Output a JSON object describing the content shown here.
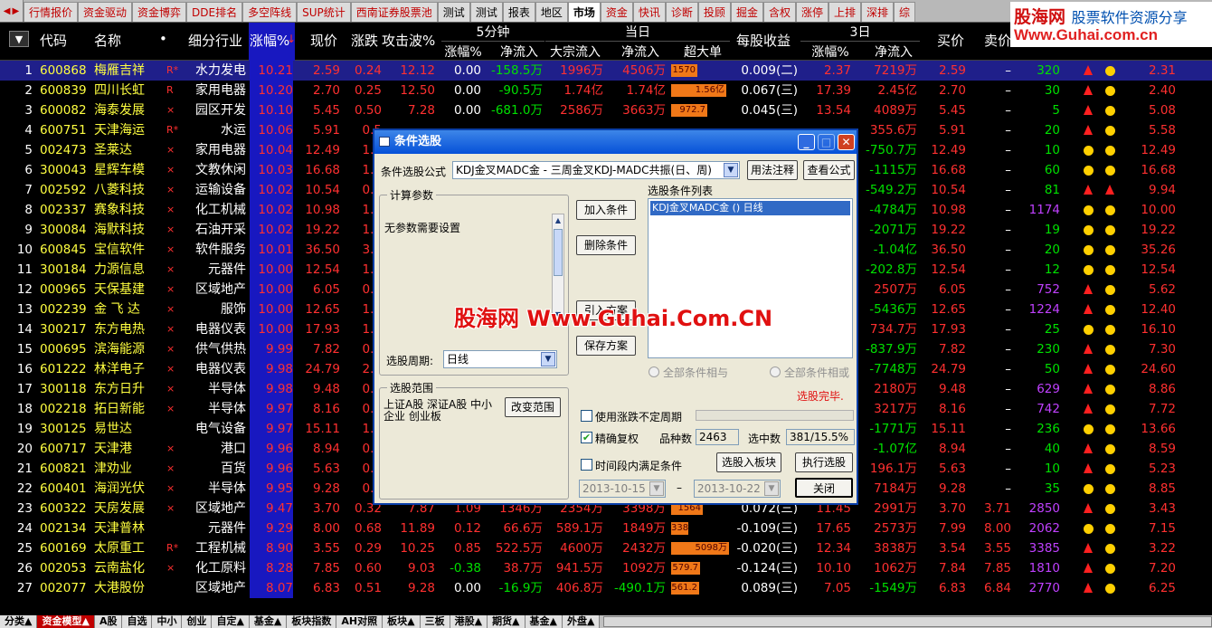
{
  "top_tabs": [
    {
      "label": "行情报价",
      "style": "red"
    },
    {
      "label": "资金驱动",
      "style": "red"
    },
    {
      "label": "资金博弈",
      "style": "red"
    },
    {
      "label": "DDE排名",
      "style": "red"
    },
    {
      "label": "多空阵线",
      "style": "red"
    },
    {
      "label": "SUP统计",
      "style": "red"
    },
    {
      "label": "西南证券股票池",
      "style": "red"
    },
    {
      "label": "测试",
      "style": "black"
    },
    {
      "label": "测试",
      "style": "black"
    },
    {
      "label": "报表",
      "style": "black"
    },
    {
      "label": "地区",
      "style": "black"
    },
    {
      "label": "市场",
      "style": "active"
    },
    {
      "label": "资金",
      "style": "red"
    },
    {
      "label": "快讯",
      "style": "red"
    },
    {
      "label": "诊断",
      "style": "red"
    },
    {
      "label": "投顾",
      "style": "red"
    },
    {
      "label": "掘金",
      "style": "red"
    },
    {
      "label": "含权",
      "style": "red"
    },
    {
      "label": "涨停",
      "style": "red"
    },
    {
      "label": "上排",
      "style": "red"
    },
    {
      "label": "深排",
      "style": "red"
    },
    {
      "label": "综",
      "style": "red"
    }
  ],
  "logo": {
    "name": "股海网",
    "tagline": "股票软件资源分享",
    "url": "Www.Guhai.com.cn"
  },
  "header": {
    "menu_icon": "▼",
    "code": "代码",
    "name": "名称",
    "dot": "•",
    "industry": "细分行业",
    "change_pct": "涨幅%",
    "change_arrow": "↓",
    "price": "现价",
    "change": "涨跌",
    "attack_wave": "攻击波%",
    "group_5min": "5分钟",
    "group_today": "当日",
    "group_3day": "3日",
    "sub_5min_pct": "涨幅%",
    "sub_5min_inflow": "净流入",
    "sub_block_inflow": "大宗流入",
    "sub_today_inflow": "净流入",
    "sub_super_order": "超大单",
    "eps": "每股收益",
    "sub_3d_pct": "涨幅%",
    "sub_3d_inflow": "净流入",
    "bid": "买价",
    "ask": "卖价"
  },
  "rows": [
    {
      "no": "1",
      "code": "600868",
      "name": "梅雁吉祥",
      "flag": "R*",
      "ind": "水力发电",
      "pct": "10.21",
      "price": "2.59",
      "chg": "0.24",
      "atk": "12.12",
      "m5": "0.00",
      "m5in": "-158.5万",
      "blk": "1996万",
      "net": "4506万",
      "sup": "1570万",
      "supv": 0.45,
      "eps": "0.009(二)",
      "d3": "2.37",
      "d3in": "7219万",
      "bid": "2.59",
      "ask": "–",
      "vol": "320",
      "i1": "tri",
      "i2": "dot",
      "last": "2.31"
    },
    {
      "no": "2",
      "code": "600839",
      "name": "四川长虹",
      "flag": "R",
      "ind": "家用电器",
      "pct": "10.20",
      "price": "2.70",
      "chg": "0.25",
      "atk": "12.50",
      "m5": "0.00",
      "m5in": "-90.5万",
      "blk": "1.74亿",
      "net": "1.74亿",
      "sup": "1.56亿",
      "supv": 0.95,
      "eps": "0.067(三)",
      "d3": "17.39",
      "d3in": "2.45亿",
      "bid": "2.70",
      "ask": "–",
      "vol": "30",
      "i1": "tri",
      "i2": "dot",
      "last": "2.40"
    },
    {
      "no": "3",
      "code": "600082",
      "name": "海泰发展",
      "flag": "×",
      "ind": "园区开发",
      "pct": "10.10",
      "price": "5.45",
      "chg": "0.50",
      "atk": "7.28",
      "m5": "0.00",
      "m5in": "-681.0万",
      "blk": "2586万",
      "net": "3663万",
      "sup": "972.7万",
      "supv": 0.62,
      "eps": "0.045(三)",
      "d3": "13.54",
      "d3in": "4089万",
      "bid": "5.45",
      "ask": "–",
      "vol": "5",
      "i1": "tri",
      "i2": "dot",
      "last": "5.08"
    },
    {
      "no": "4",
      "code": "600751",
      "name": "天津海运",
      "flag": "R*",
      "ind": "水运",
      "pct": "10.06",
      "price": "5.91",
      "chg": "0.5",
      "atk": "",
      "m5": "",
      "m5in": "",
      "blk": "",
      "net": "",
      "sup": "",
      "supv": 0,
      "eps": "",
      "d3": "",
      "d3in": "355.6万",
      "bid": "5.91",
      "ask": "–",
      "vol": "20",
      "i1": "tri",
      "i2": "dot",
      "last": "5.58"
    },
    {
      "no": "5",
      "code": "002473",
      "name": "圣莱达",
      "flag": "×",
      "ind": "家用电器",
      "pct": "10.04",
      "price": "12.49",
      "chg": "1.1",
      "atk": "",
      "m5": "",
      "m5in": "",
      "blk": "",
      "net": "",
      "sup": "",
      "supv": 0,
      "eps": "",
      "d3": "",
      "d3in": "-750.7万",
      "bid": "12.49",
      "ask": "–",
      "vol": "10",
      "i1": "dot",
      "i2": "dot",
      "last": "12.49"
    },
    {
      "no": "6",
      "code": "300043",
      "name": "星辉车模",
      "flag": "×",
      "ind": "文教休闲",
      "pct": "10.03",
      "price": "16.68",
      "chg": "1.5",
      "atk": "",
      "m5": "",
      "m5in": "",
      "blk": "",
      "net": "",
      "sup": "",
      "supv": 0,
      "eps": "",
      "d3": "",
      "d3in": "-1115万",
      "bid": "16.68",
      "ask": "–",
      "vol": "60",
      "i1": "dot",
      "i2": "dot",
      "last": "16.68"
    },
    {
      "no": "7",
      "code": "002592",
      "name": "八菱科技",
      "flag": "×",
      "ind": "运输设备",
      "pct": "10.02",
      "price": "10.54",
      "chg": "0.9",
      "atk": "",
      "m5": "",
      "m5in": "",
      "blk": "",
      "net": "",
      "sup": "",
      "supv": 0,
      "eps": "",
      "d3": "",
      "d3in": "-549.2万",
      "bid": "10.54",
      "ask": "–",
      "vol": "81",
      "i1": "tri",
      "i2": "tri",
      "last": "9.94"
    },
    {
      "no": "8",
      "code": "002337",
      "name": "赛象科技",
      "flag": "×",
      "ind": "化工机械",
      "pct": "10.02",
      "price": "10.98",
      "chg": "1.0",
      "atk": "",
      "m5": "",
      "m5in": "",
      "blk": "",
      "net": "",
      "sup": "",
      "supv": 0,
      "eps": "",
      "d3": "",
      "d3in": "-4784万",
      "bid": "10.98",
      "ask": "–",
      "vol": "1174",
      "i1": "dot",
      "i2": "dot",
      "last": "10.00"
    },
    {
      "no": "9",
      "code": "300084",
      "name": "海默科技",
      "flag": "×",
      "ind": "石油开采",
      "pct": "10.02",
      "price": "19.22",
      "chg": "1.7",
      "atk": "",
      "m5": "",
      "m5in": "",
      "blk": "",
      "net": "",
      "sup": "",
      "supv": 0,
      "eps": "",
      "d3": "",
      "d3in": "-2071万",
      "bid": "19.22",
      "ask": "–",
      "vol": "19",
      "i1": "dot",
      "i2": "dot",
      "last": "19.22"
    },
    {
      "no": "10",
      "code": "600845",
      "name": "宝信软件",
      "flag": "×",
      "ind": "软件服务",
      "pct": "10.01",
      "price": "36.50",
      "chg": "3.3",
      "atk": "",
      "m5": "",
      "m5in": "",
      "blk": "",
      "net": "",
      "sup": "",
      "supv": 0,
      "eps": "",
      "d3": "",
      "d3in": "-1.04亿",
      "bid": "36.50",
      "ask": "–",
      "vol": "20",
      "i1": "dot",
      "i2": "dot",
      "last": "35.26"
    },
    {
      "no": "11",
      "code": "300184",
      "name": "力源信息",
      "flag": "×",
      "ind": "元器件",
      "pct": "10.00",
      "price": "12.54",
      "chg": "1.1",
      "atk": "",
      "m5": "",
      "m5in": "",
      "blk": "",
      "net": "",
      "sup": "",
      "supv": 0,
      "eps": "",
      "d3": "",
      "d3in": "-202.8万",
      "bid": "12.54",
      "ask": "–",
      "vol": "12",
      "i1": "dot",
      "i2": "dot",
      "last": "12.54"
    },
    {
      "no": "12",
      "code": "000965",
      "name": "天保基建",
      "flag": "×",
      "ind": "区域地产",
      "pct": "10.00",
      "price": "6.05",
      "chg": "0.5",
      "atk": "",
      "m5": "",
      "m5in": "",
      "blk": "",
      "net": "",
      "sup": "",
      "supv": 0,
      "eps": "",
      "d3": "",
      "d3in": "2507万",
      "bid": "6.05",
      "ask": "–",
      "vol": "752",
      "i1": "tri",
      "i2": "dot",
      "last": "5.62"
    },
    {
      "no": "13",
      "code": "002239",
      "name": "金 飞 达",
      "flag": "×",
      "ind": "服饰",
      "pct": "10.00",
      "price": "12.65",
      "chg": "1.1",
      "atk": "",
      "m5": "",
      "m5in": "",
      "blk": "",
      "net": "",
      "sup": "",
      "supv": 0,
      "eps": "",
      "d3": "",
      "d3in": "-5436万",
      "bid": "12.65",
      "ask": "–",
      "vol": "1224",
      "i1": "tri",
      "i2": "dot",
      "last": "12.40"
    },
    {
      "no": "14",
      "code": "300217",
      "name": "东方电热",
      "flag": "×",
      "ind": "电器仪表",
      "pct": "10.00",
      "price": "17.93",
      "chg": "1.6",
      "atk": "",
      "m5": "",
      "m5in": "",
      "blk": "",
      "net": "",
      "sup": "",
      "supv": 0,
      "eps": "",
      "d3": "",
      "d3in": "734.7万",
      "bid": "17.93",
      "ask": "–",
      "vol": "25",
      "i1": "dot",
      "i2": "dot",
      "last": "16.10"
    },
    {
      "no": "15",
      "code": "000695",
      "name": "滨海能源",
      "flag": "×",
      "ind": "供气供热",
      "pct": "9.99",
      "price": "7.82",
      "chg": "0.7",
      "atk": "",
      "m5": "",
      "m5in": "",
      "blk": "",
      "net": "",
      "sup": "",
      "supv": 0,
      "eps": "",
      "d3": "",
      "d3in": "-837.9万",
      "bid": "7.82",
      "ask": "–",
      "vol": "230",
      "i1": "tri",
      "i2": "dot",
      "last": "7.30"
    },
    {
      "no": "16",
      "code": "601222",
      "name": "林洋电子",
      "flag": "×",
      "ind": "电器仪表",
      "pct": "9.98",
      "price": "24.79",
      "chg": "2.2",
      "atk": "",
      "m5": "",
      "m5in": "",
      "blk": "",
      "net": "",
      "sup": "",
      "supv": 0,
      "eps": "",
      "d3": "",
      "d3in": "-7748万",
      "bid": "24.79",
      "ask": "–",
      "vol": "50",
      "i1": "tri",
      "i2": "dot",
      "last": "24.60"
    },
    {
      "no": "17",
      "code": "300118",
      "name": "东方日升",
      "flag": "×",
      "ind": "半导体",
      "pct": "9.98",
      "price": "9.48",
      "chg": "0.8",
      "atk": "",
      "m5": "",
      "m5in": "",
      "blk": "",
      "net": "",
      "sup": "",
      "supv": 0,
      "eps": "",
      "d3": "",
      "d3in": "2180万",
      "bid": "9.48",
      "ask": "–",
      "vol": "629",
      "i1": "tri",
      "i2": "dot",
      "last": "8.86"
    },
    {
      "no": "18",
      "code": "002218",
      "name": "拓日新能",
      "flag": "×",
      "ind": "半导体",
      "pct": "9.97",
      "price": "8.16",
      "chg": "0.7",
      "atk": "",
      "m5": "",
      "m5in": "",
      "blk": "",
      "net": "",
      "sup": "",
      "supv": 0,
      "eps": "",
      "d3": "",
      "d3in": "3217万",
      "bid": "8.16",
      "ask": "–",
      "vol": "742",
      "i1": "tri",
      "i2": "dot",
      "last": "7.72"
    },
    {
      "no": "19",
      "code": "300125",
      "name": "易世达",
      "flag": "",
      "ind": "电气设备",
      "pct": "9.97",
      "price": "15.11",
      "chg": "1.3",
      "atk": "",
      "m5": "",
      "m5in": "",
      "blk": "",
      "net": "",
      "sup": "",
      "supv": 0,
      "eps": "",
      "d3": "",
      "d3in": "-1771万",
      "bid": "15.11",
      "ask": "–",
      "vol": "236",
      "i1": "dot",
      "i2": "dot",
      "last": "13.66"
    },
    {
      "no": "20",
      "code": "600717",
      "name": "天津港",
      "flag": "×",
      "ind": "港口",
      "pct": "9.96",
      "price": "8.94",
      "chg": "0.8",
      "atk": "",
      "m5": "",
      "m5in": "",
      "blk": "",
      "net": "",
      "sup": "",
      "supv": 0,
      "eps": "",
      "d3": "",
      "d3in": "-1.07亿",
      "bid": "8.94",
      "ask": "–",
      "vol": "40",
      "i1": "tri",
      "i2": "dot",
      "last": "8.59"
    },
    {
      "no": "21",
      "code": "600821",
      "name": "津劝业",
      "flag": "×",
      "ind": "百货",
      "pct": "9.96",
      "price": "5.63",
      "chg": "0.5",
      "atk": "",
      "m5": "",
      "m5in": "",
      "blk": "",
      "net": "",
      "sup": "",
      "supv": 0,
      "eps": "",
      "d3": "",
      "d3in": "196.1万",
      "bid": "5.63",
      "ask": "–",
      "vol": "10",
      "i1": "tri",
      "i2": "dot",
      "last": "5.23"
    },
    {
      "no": "22",
      "code": "600401",
      "name": "海润光伏",
      "flag": "×",
      "ind": "半导体",
      "pct": "9.95",
      "price": "9.28",
      "chg": "0.8",
      "atk": "",
      "m5": "",
      "m5in": "",
      "blk": "",
      "net": "",
      "sup": "",
      "supv": 0,
      "eps": "",
      "d3": "",
      "d3in": "7184万",
      "bid": "9.28",
      "ask": "–",
      "vol": "35",
      "i1": "dot",
      "i2": "dot",
      "last": "8.85"
    },
    {
      "no": "23",
      "code": "600322",
      "name": "天房发展",
      "flag": "×",
      "ind": "区域地产",
      "pct": "9.47",
      "price": "3.70",
      "chg": "0.32",
      "atk": "7.87",
      "m5": "1.09",
      "m5in": "1346万",
      "blk": "2354万",
      "net": "3398万",
      "sup": "1564万",
      "supv": 0.55,
      "eps": "0.072(三)",
      "d3": "11.45",
      "d3in": "2991万",
      "bid": "3.70",
      "ask": "3.71",
      "vol": "2850",
      "i1": "tri",
      "i2": "dot",
      "last": "3.43"
    },
    {
      "no": "24",
      "code": "002134",
      "name": "天津普林",
      "flag": "",
      "ind": "元器件",
      "pct": "9.29",
      "price": "8.00",
      "chg": "0.68",
      "atk": "11.89",
      "m5": "0.12",
      "m5in": "66.6万",
      "blk": "589.1万",
      "net": "1849万",
      "sup": "338.1万",
      "supv": 0.3,
      "eps": "-0.109(三)",
      "d3": "17.65",
      "d3in": "2573万",
      "bid": "7.99",
      "ask": "8.00",
      "vol": "2062",
      "i1": "dot",
      "i2": "dot",
      "last": "7.15"
    },
    {
      "no": "25",
      "code": "600169",
      "name": "太原重工",
      "flag": "R*",
      "ind": "工程机械",
      "pct": "8.90",
      "price": "3.55",
      "chg": "0.29",
      "atk": "10.25",
      "m5": "0.85",
      "m5in": "522.5万",
      "blk": "4600万",
      "net": "2432万",
      "sup": "5098万",
      "supv": 1.0,
      "eps": "-0.020(三)",
      "d3": "12.34",
      "d3in": "3838万",
      "bid": "3.54",
      "ask": "3.55",
      "vol": "3385",
      "i1": "tri",
      "i2": "dot",
      "last": "3.22"
    },
    {
      "no": "26",
      "code": "002053",
      "name": "云南盐化",
      "flag": "×",
      "ind": "化工原料",
      "pct": "8.28",
      "price": "7.85",
      "chg": "0.60",
      "atk": "9.03",
      "m5": "-0.38",
      "m5in": "38.7万",
      "blk": "941.5万",
      "net": "1092万",
      "sup": "579.7万",
      "supv": 0.5,
      "eps": "-0.124(三)",
      "d3": "10.10",
      "d3in": "1062万",
      "bid": "7.84",
      "ask": "7.85",
      "vol": "1810",
      "i1": "tri",
      "i2": "dot",
      "last": "7.20"
    },
    {
      "no": "27",
      "code": "002077",
      "name": "大港股份",
      "flag": "",
      "ind": "区域地产",
      "pct": "8.07",
      "price": "6.83",
      "chg": "0.51",
      "atk": "9.28",
      "m5": "0.00",
      "m5in": "-16.9万",
      "blk": "406.8万",
      "net": "-490.1万",
      "sup": "561.2万",
      "supv": 0.48,
      "eps": "0.089(三)",
      "d3": "7.05",
      "d3in": "-1549万",
      "bid": "6.83",
      "ask": "6.84",
      "vol": "2770",
      "i1": "tri",
      "i2": "dot",
      "last": "6.25"
    }
  ],
  "dialog": {
    "title": "条件选股",
    "formula_label": "条件选股公式",
    "formula_value": "KDJ金叉MADC金 - 三周金叉KDJ-MADC共振(日、周)",
    "usage_btn": "用法注释",
    "view_formula_btn": "查看公式",
    "params_group": "计算参数",
    "params_text": "无参数需要设置",
    "period_label": "选股周期:",
    "period_value": "日线",
    "add_btn": "加入条件",
    "delete_btn": "删除条件",
    "import_btn": "引入方案",
    "save_btn": "保存方案",
    "list_label": "选股条件列表",
    "list_items": [
      "KDJ金叉MADC金  () 日线"
    ],
    "radio_and": "全部条件相与",
    "radio_or": "全部条件相或",
    "status": "选股完毕.",
    "range_group": "选股范围",
    "range_text": "上证A股 深证A股 中小企业 创业板",
    "change_range_btn": "改变范围",
    "chk_uncertain": "使用涨跌不定周期",
    "chk_exact": "精确复权",
    "count_label": "品种数",
    "count_value": "2463",
    "selected_label": "选中数",
    "selected_value": "381/15.5%",
    "chk_period": "时间段内满足条件",
    "date_from": "2013-10-15",
    "date_sep": "–",
    "date_to": "2013-10-22",
    "to_block_btn": "选股入板块",
    "execute_btn": "执行选股",
    "close_btn": "关闭"
  },
  "watermark": "股海网 Www.Guhai.Com.CN",
  "bottom_tabs": [
    {
      "label": "分类▲",
      "active": false
    },
    {
      "label": "资金模型▲",
      "active": true
    },
    {
      "label": "A股",
      "active": false
    },
    {
      "label": "自选",
      "active": false
    },
    {
      "label": "中小",
      "active": false
    },
    {
      "label": "创业",
      "active": false
    },
    {
      "label": "自定▲",
      "active": false
    },
    {
      "label": "基金▲",
      "active": false
    },
    {
      "label": "板块指数",
      "active": false
    },
    {
      "label": "AH对照",
      "active": false
    },
    {
      "label": "板块▲",
      "active": false
    },
    {
      "label": "三板",
      "active": false
    },
    {
      "label": "港股▲",
      "active": false
    },
    {
      "label": "期货▲",
      "active": false
    },
    {
      "label": "基金▲",
      "active": false
    },
    {
      "label": "外盘▲",
      "active": false
    }
  ],
  "colors": {
    "red": "#ff3030",
    "green": "#00e000",
    "yellow": "#ffff40",
    "white": "#ffffff",
    "magenta": "#c040ff",
    "cyan": "#40e0ff"
  }
}
